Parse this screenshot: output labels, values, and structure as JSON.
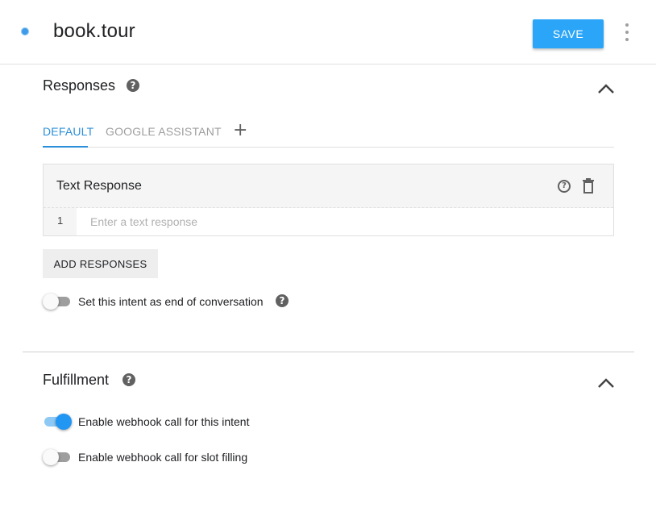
{
  "header": {
    "intent_name": "book.tour",
    "save_label": "SAVE",
    "more_icon": "more-vert-icon"
  },
  "responses": {
    "title": "Responses",
    "tabs": [
      {
        "label": "DEFAULT",
        "active": true
      },
      {
        "label": "GOOGLE ASSISTANT",
        "active": false
      }
    ],
    "add_tab_icon": "+",
    "text_response": {
      "title": "Text Response",
      "help_icon": "?",
      "rows": [
        {
          "number": "1",
          "value": "",
          "placeholder": "Enter a text response"
        }
      ]
    },
    "add_responses_label": "ADD RESPONSES",
    "end_conversation": {
      "label": "Set this intent as end of conversation",
      "enabled": false
    }
  },
  "fulfillment": {
    "title": "Fulfillment",
    "webhook_intent": {
      "label": "Enable webhook call for this intent",
      "enabled": true
    },
    "webhook_slot": {
      "label": "Enable webhook call for slot filling",
      "enabled": false
    }
  },
  "colors": {
    "accent": "#2ba5f7",
    "tab_active": "#2b8fd9",
    "toggle_on": "#2196f3"
  }
}
